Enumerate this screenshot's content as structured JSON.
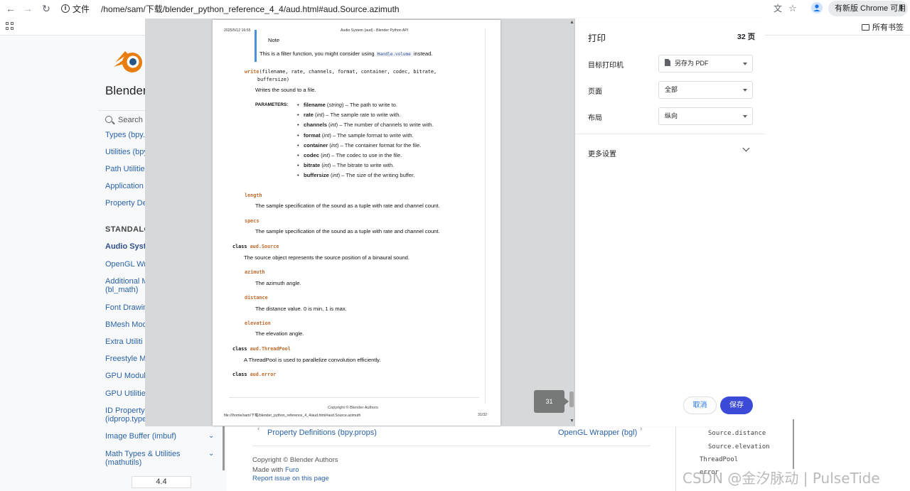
{
  "browser": {
    "menu_label": "文件",
    "url": "/home/sam/下载/blender_python_reference_4_4/aud.html#aud.Source.azimuth",
    "update_label": "有新版 Chrome 可用",
    "all_bookmarks": "所有书签"
  },
  "docs": {
    "site_title": "Blender",
    "search_placeholder": "Search",
    "sidebar_items": [
      "Types (bpy.t",
      "Utilities (bpy",
      "Path Utilities",
      "Application",
      "Property De"
    ],
    "standalone_caption": "STANDALO",
    "current_item": "Audio Syst",
    "sidebar_items2": [
      "OpenGL Wr",
      "Additional M",
      "(bl_math)",
      "Font Drawin",
      "BMesh Mod",
      "Extra Utiliti",
      "Freestyle M",
      "GPU Modul",
      "GPU Utilitie",
      "ID Property",
      "(idprop.type",
      "Image Buffer (imbuf)",
      "Math Types & Utilities",
      "(mathutils)"
    ],
    "version": "4.4",
    "prev_link": "Property Definitions (bpy.props)",
    "next_link": "OpenGL Wrapper (bgl)",
    "footer_copyright": "Copyright © Blender Authors",
    "footer_made_prefix": "Made with ",
    "footer_made_link": "Furo",
    "footer_report": "Report issue on this page",
    "toc": [
      "Source.distance",
      "Source.elevation",
      "ThreadPool",
      "error"
    ],
    "watermark": "CSDN @金汐脉动 | PulseTide"
  },
  "preview_page": {
    "header_date": "2025/5/12 16:55",
    "header_title": "Audio System (aud) - Blender Python API",
    "note_title": "Note",
    "note_text_pre": "This is a filter function, you might consider using ",
    "note_code": "Handle.volume",
    "note_text_post": " instead.",
    "write_sig_name": "write",
    "write_sig_args": "(filename, rate, channels, format, container, codec, bitrate,",
    "write_sig_args2": "buffersize)",
    "write_desc": "Writes the sound to a file.",
    "parameters_label": "PARAMETERS:",
    "params": [
      {
        "name": "filename",
        "type": "string",
        "desc": " – The path to write to."
      },
      {
        "name": "rate",
        "type": "int",
        "desc": " – The sample rate to write with."
      },
      {
        "name": "channels",
        "type": "int",
        "desc": " – The number of channels to write with."
      },
      {
        "name": "format",
        "type": "int",
        "desc": " – The sample format to write with."
      },
      {
        "name": "container",
        "type": "int",
        "desc": " – The container format for the file."
      },
      {
        "name": "codec",
        "type": "int",
        "desc": " – The codec to use in the file."
      },
      {
        "name": "bitrate",
        "type": "int",
        "desc": " – The bitrate to write with."
      },
      {
        "name": "buffersize",
        "type": "int",
        "desc": " – The size of the writing buffer."
      }
    ],
    "length_name": "length",
    "length_desc": "The sample specification of the sound as a tuple with rate and channel count.",
    "specs_name": "specs",
    "specs_desc": "The sample specification of the sound as a tuple with rate and channel count.",
    "class_kw": "class",
    "class_mod": "aud.",
    "source_name": "Source",
    "source_desc": "The source object represents the source position of a binaural sound.",
    "azimuth_name": "azimuth",
    "azimuth_desc": "The azimuth angle.",
    "distance_name": "distance",
    "distance_desc": "The distance value. 0 is min, 1 is max.",
    "elevation_name": "elevation",
    "elevation_desc": "The elevation angle.",
    "threadpool_name": "ThreadPool",
    "threadpool_desc": "A ThreadPool is used to parallelize convolution efficiently.",
    "error_name": "error",
    "footer_copyright": "Copyright © Blender Authors",
    "footer_url": "file:///home/sam/下载/blender_python_reference_4_4/aud.html#aud.Source.azimuth",
    "footer_pagenum": "31/32"
  },
  "print_panel": {
    "title": "打印",
    "page_count": "32 页",
    "destination_label": "目标打印机",
    "destination_value": "另存为 PDF",
    "pages_label": "页面",
    "pages_value": "全部",
    "layout_label": "布局",
    "layout_value": "纵向",
    "more_settings": "更多设置",
    "cancel": "取消",
    "save": "保存",
    "current_page_badge": "31"
  },
  "colors": {
    "save_button": "#3b4bd8",
    "link": "#2962a8",
    "code_name": "#c0692a"
  }
}
